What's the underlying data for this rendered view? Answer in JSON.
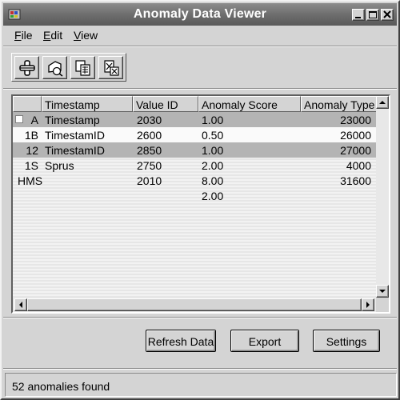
{
  "window": {
    "title": "Anomaly Data Viewer"
  },
  "menu": {
    "file": {
      "accel": "F",
      "rest": "ile"
    },
    "edit": {
      "accel": "E",
      "rest": "dit"
    },
    "view": {
      "accel": "V",
      "rest": "iew"
    }
  },
  "toolbar": {
    "icons": [
      "add-row-icon",
      "edit-icon",
      "copy-icon",
      "delete-icon"
    ]
  },
  "grid": {
    "columns": [
      "",
      "Timestamp",
      "Value ID",
      "Anomaly Score",
      "Anomaly Type"
    ],
    "rows": [
      {
        "id": "A",
        "name": "Timestamp",
        "value_id": "2030",
        "score": "1.00",
        "type": "23000",
        "style": "selected",
        "checkbox": true
      },
      {
        "id": "1B",
        "name": "TimestamID",
        "value_id": "2600",
        "score": "0.50",
        "type": "26000",
        "style": "light"
      },
      {
        "id": "12",
        "name": "TimestamID",
        "value_id": "2850",
        "score": "1.00",
        "type": "27000",
        "style": "selected"
      },
      {
        "id": "1S",
        "name": "Sprus",
        "value_id": "2750",
        "score": "2.00",
        "type": "4000",
        "style": "plain"
      },
      {
        "id": "HMS",
        "name": "",
        "value_id": "2010",
        "score": "8.00",
        "type": "31600",
        "style": "plain"
      },
      {
        "id": "",
        "name": "",
        "value_id": "",
        "score": "2.00",
        "type": "",
        "style": "plain"
      }
    ]
  },
  "buttons": {
    "refresh": "Refresh Data",
    "export": "Export",
    "settings": "Settings"
  },
  "status": {
    "text": "52 anomalies found"
  },
  "colors": {
    "titlebar": "#6e6e6e",
    "face": "#d4d4d4",
    "selected_row": "#b4b4b4"
  }
}
